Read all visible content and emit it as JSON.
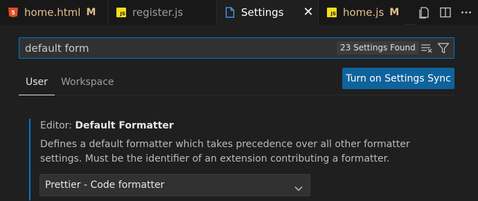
{
  "tabs": [
    {
      "label": "home.html",
      "badge": "M",
      "icon": "html5-file-icon",
      "modified": true,
      "active": false
    },
    {
      "label": "register.js",
      "icon": "javascript-file-icon",
      "modified": false,
      "active": false
    },
    {
      "label": "Settings",
      "icon": "settings-file-icon",
      "active": true,
      "close_glyph": "✕"
    },
    {
      "label": "home.js",
      "badge": "M",
      "icon": "javascript-file-icon",
      "modified": true,
      "active": false
    }
  ],
  "tab_actions": [
    "open-changes-icon",
    "split-editor-icon",
    "more-actions-icon"
  ],
  "search": {
    "value": "default form",
    "result_count": "23 Settings Found",
    "clear_icon": "clear-filter-icon",
    "filter_icon": "filter-icon"
  },
  "scope": {
    "tabs": [
      "User",
      "Workspace"
    ],
    "active": "User",
    "sync_button": "Turn on Settings Sync"
  },
  "setting": {
    "category": "Editor: ",
    "name": "Default Formatter",
    "description": "Defines a default formatter which takes precedence over all other formatter settings. Must be the identifier of an extension contributing a formatter.",
    "selected_value": "Prettier - Code formatter"
  },
  "colors": {
    "accent": "#0078d4",
    "sync_button": "#0e639c",
    "modified": "#e2c08d",
    "html_icon": "#e44d26",
    "js_icon": "#f5de19"
  }
}
